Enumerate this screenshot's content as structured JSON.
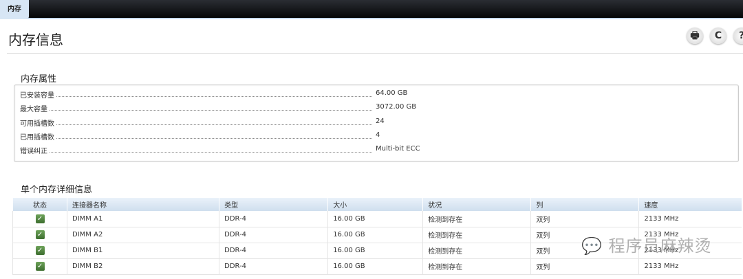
{
  "tab": "内存",
  "title": "内存信息",
  "toolbar": {
    "print": "🖶",
    "refresh": "C",
    "help": "?"
  },
  "props": {
    "heading": "内存属性",
    "rows": [
      {
        "label": "已安装容量",
        "value": "64.00 GB"
      },
      {
        "label": "最大容量",
        "value": "3072.00 GB"
      },
      {
        "label": "可用插槽数",
        "value": "24"
      },
      {
        "label": "已用插槽数",
        "value": "4"
      },
      {
        "label": "错误纠正",
        "value": "Multi-bit ECC"
      }
    ]
  },
  "detail": {
    "heading": "单个内存详细信息",
    "columns": [
      "状态",
      "连接器名称",
      "类型",
      "大小",
      "状况",
      "列",
      "速度"
    ],
    "rows": [
      {
        "status": "✓",
        "name": "DIMM A1",
        "type": "DDR-4",
        "size": "16.00 GB",
        "cond": "检测到存在",
        "rank": "双列",
        "speed": "2133 MHz"
      },
      {
        "status": "✓",
        "name": "DIMM A2",
        "type": "DDR-4",
        "size": "16.00 GB",
        "cond": "检测到存在",
        "rank": "双列",
        "speed": "2133 MHz"
      },
      {
        "status": "✓",
        "name": "DIMM B1",
        "type": "DDR-4",
        "size": "16.00 GB",
        "cond": "检测到存在",
        "rank": "双列",
        "speed": "2133 MHz"
      },
      {
        "status": "✓",
        "name": "DIMM B2",
        "type": "DDR-4",
        "size": "16.00 GB",
        "cond": "检测到存在",
        "rank": "双列",
        "speed": "2133 MHz"
      }
    ]
  },
  "watermark": "程序员麻辣烫"
}
